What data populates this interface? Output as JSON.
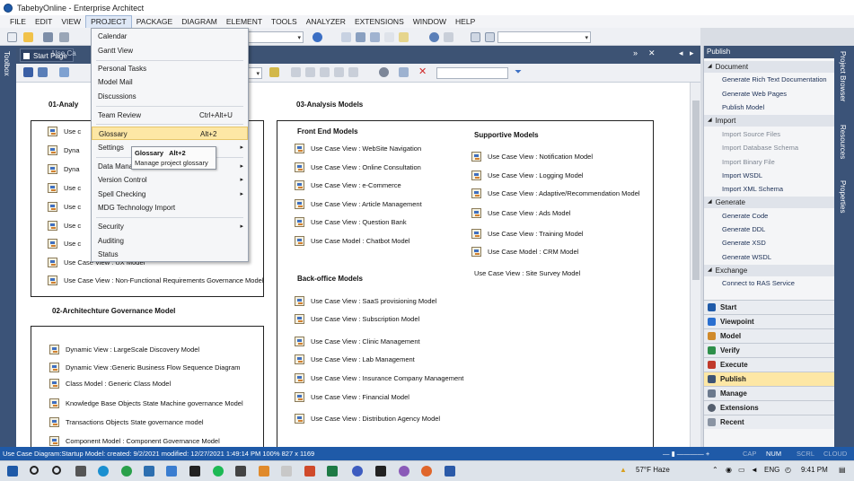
{
  "window": {
    "title": "TabebyOnline - Enterprise Architect"
  },
  "menubar": [
    "FILE",
    "EDIT",
    "VIEW",
    "PROJECT",
    "PACKAGE",
    "DIAGRAM",
    "ELEMENT",
    "TOOLS",
    "ANALYZER",
    "EXTENSIONS",
    "WINDOW",
    "HELP"
  ],
  "menubar_active": "PROJECT",
  "left_strip": {
    "label": "Toolbox"
  },
  "tabs": {
    "start": "Start Page",
    "diagram_tab": "Use Ca"
  },
  "project_menu": {
    "items": [
      {
        "label": "Calendar",
        "shortcut": "",
        "arrow": ""
      },
      {
        "label": "Gantt View",
        "shortcut": "",
        "arrow": ""
      },
      {
        "label": "Personal Tasks",
        "shortcut": "",
        "arrow": ""
      },
      {
        "label": "Model Mail",
        "shortcut": "",
        "arrow": ""
      },
      {
        "label": "Discussions",
        "shortcut": "",
        "arrow": ""
      },
      {
        "label": "Team Review",
        "shortcut": "Ctrl+Alt+U",
        "arrow": ""
      },
      {
        "label": "Glossary",
        "shortcut": "Alt+2",
        "arrow": ""
      },
      {
        "label": "Settings",
        "shortcut": "",
        "arrow": "▸"
      },
      {
        "label": "Data Mana",
        "shortcut": "",
        "arrow": "▸"
      },
      {
        "label": "Version Control",
        "shortcut": "",
        "arrow": "▸"
      },
      {
        "label": "Spell Checking",
        "shortcut": "",
        "arrow": "▸"
      },
      {
        "label": "MDG Technology Import",
        "shortcut": "",
        "arrow": ""
      },
      {
        "label": "Security",
        "shortcut": "",
        "arrow": "▸"
      },
      {
        "label": "Auditing",
        "shortcut": "",
        "arrow": ""
      },
      {
        "label": "Status",
        "shortcut": "",
        "arrow": ""
      }
    ]
  },
  "tooltip": {
    "title": "Glossary",
    "shortcut": "Alt+2",
    "description": "Manage project glossary"
  },
  "diagram": {
    "section1": {
      "title": "01-Analy",
      "items": [
        "Use c",
        "Dyna",
        "Dyna",
        "Use c",
        "Use c",
        "Use c",
        "Use c",
        "Use Case View : UX Model",
        "Use Case View : Non-Functional Requirements Governance Model"
      ]
    },
    "section2": {
      "title": "02-Architechture Governance Model",
      "items": [
        "Dynamic View : LargeScale Discovery Model",
        "Dynamic View :Generic Business Flow Sequence Diagram",
        "Class Model : Generic Class Model",
        "Knowledge Base Objects State Machine governance Model",
        "Transactions Objects State governance model",
        "Component Model : Component Governance Model"
      ]
    },
    "section3": {
      "title": "03-Analysis Models",
      "front_end_title": "Front End Models",
      "front_end": [
        "Use Case View : WebSite Navigation",
        "Use Case View : Online Consultation",
        "Use Case View : e-Commerce",
        "Use Case View : Article Management",
        "Use Case View : Question Bank",
        "Use Case Model : Chatbot Model"
      ],
      "supportive_title": "Supportive Models",
      "supportive": [
        "Use Case View : Notification Model",
        "Use Case View : Logging Model",
        "Use Case View : Adaptive/Recommendation Model",
        "Use Case View : Ads Model",
        "Use Case View : Training Model",
        "Use Case Model : CRM Model",
        "Use Case View : Site Survey Model"
      ],
      "backoffice_title": "Back-office Models",
      "backoffice": [
        "Use Case View : SaaS provisioning Model",
        "Use Case View : Subscription Model",
        "Use Case View : Clinic Management",
        "Use Case View : Lab Management",
        "Use Case View : Insurance Company Management",
        "Use Case View : Financial Model",
        "Use Case View : Distribution Agency Model"
      ]
    }
  },
  "publish_panel": {
    "title": "Publish",
    "sections": [
      {
        "name": "Document",
        "links": [
          "Generate Rich Text Documentation",
          "Generate Web Pages",
          "Publish Model"
        ]
      },
      {
        "name": "Import",
        "links": [
          "Import Source Files",
          "Import Database Schema",
          "Import Binary File",
          "Import WSDL",
          "Import XML Schema"
        ]
      },
      {
        "name": "Generate",
        "links": [
          "Generate Code",
          "Generate DDL",
          "Generate XSD",
          "Generate WSDL"
        ]
      },
      {
        "name": "Exchange",
        "links": [
          "Connect to RAS Service"
        ]
      }
    ],
    "nav": [
      "Start",
      "Viewpoint",
      "Model",
      "Verify",
      "Execute",
      "Publish",
      "Manage",
      "Extensions",
      "Recent"
    ],
    "nav_selected": "Publish"
  },
  "right_strip": [
    "Project Browser",
    "Resources",
    "Properties"
  ],
  "statusbar": {
    "text": "Use Case Diagram:Startup Model:  created: 9/2/2021  modified: 12/27/2021 1:49:14 PM   100%   827 x 1169",
    "indicators": [
      "CAP",
      "NUM",
      "SCRL",
      "CLOUD"
    ]
  },
  "taskbar": {
    "weather": "57°F  Haze",
    "lang": "ENG",
    "time": "9:41 PM"
  }
}
